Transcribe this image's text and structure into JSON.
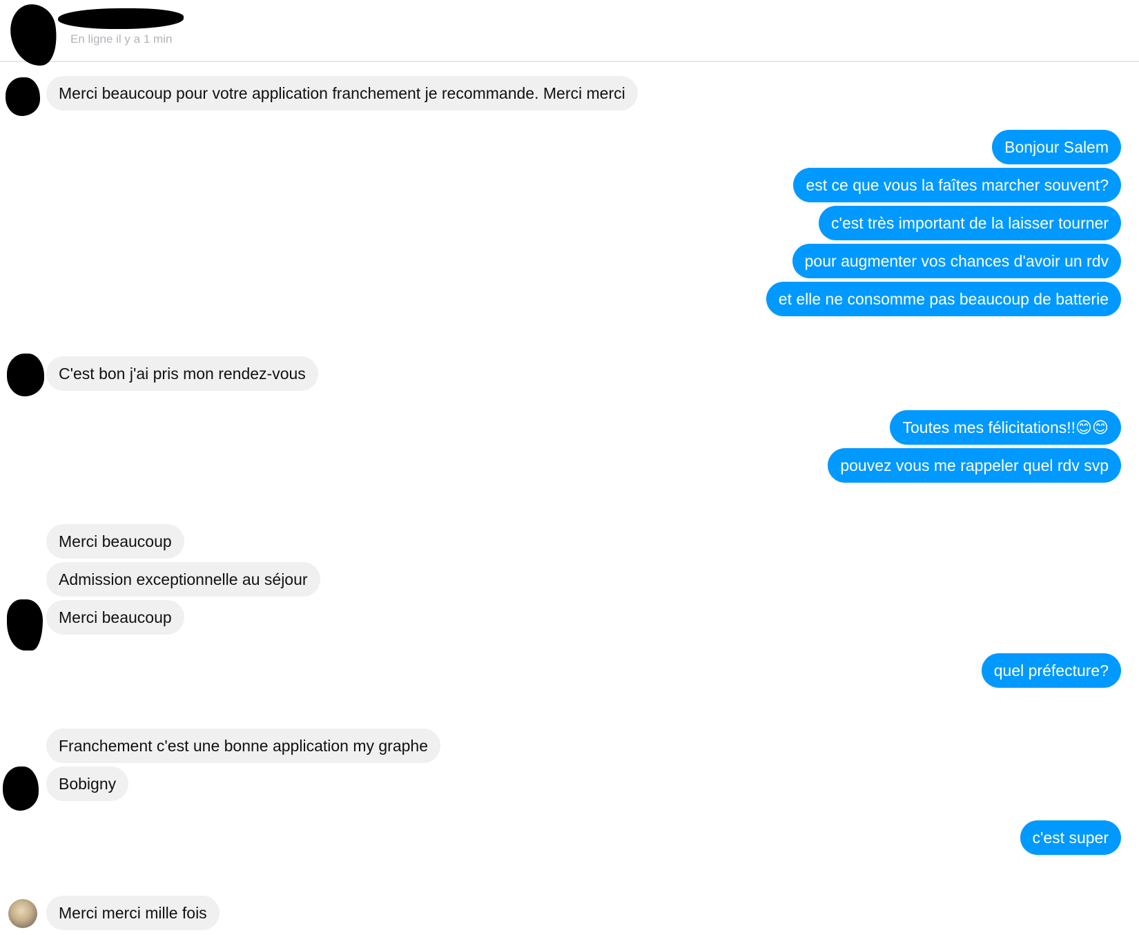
{
  "contact": {
    "status": "En ligne il y a 1 min"
  },
  "messages": {
    "m1": "Merci beaucoup pour votre application franchement je recommande. Merci merci",
    "m2": "Bonjour Salem",
    "m3": "est ce que vous la faîtes marcher souvent?",
    "m4": "c'est très important de la laisser tourner",
    "m5": "pour augmenter vos chances d'avoir un rdv",
    "m6": "et elle ne consomme pas beaucoup de batterie",
    "m7": "C'est bon j'ai pris mon rendez-vous",
    "m8": "Toutes mes félicitations!!😊😊",
    "m9": "pouvez vous me rappeler quel rdv svp",
    "m10": "Merci beaucoup",
    "m11": "Admission exceptionnelle au séjour",
    "m12": "Merci beaucoup",
    "m13": "quel préfecture?",
    "m14": "Franchement c'est une bonne application  my graphe",
    "m15": "Bobigny",
    "m16": "c'est super",
    "m17": "Merci merci mille fois"
  },
  "colors": {
    "outgoing_bubble": "#0099ff",
    "incoming_bubble": "#f0f0f0",
    "status_text": "#b0b3b8"
  }
}
